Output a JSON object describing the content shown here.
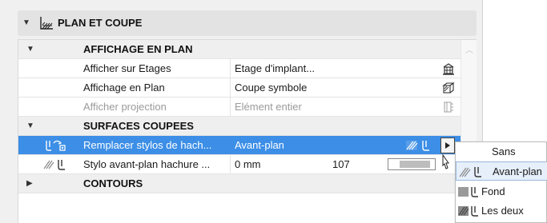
{
  "section": {
    "title": "PLAN ET COUPE",
    "icon": "plan-section-icon"
  },
  "groups": {
    "affichage": "AFFICHAGE EN PLAN",
    "surfaces": "SURFACES COUPEES",
    "contours": "CONTOURS"
  },
  "rows": {
    "afficher_etages": {
      "label": "Afficher sur Etages",
      "value": "Etage d'implant..."
    },
    "affichage_plan": {
      "label": "Affichage en Plan",
      "value": "Coupe symbole"
    },
    "afficher_projection": {
      "label": "Afficher projection",
      "value": "Elément entier"
    },
    "remplacer_stylos": {
      "label": "Remplacer stylos de hach...",
      "value": "Avant-plan"
    },
    "stylo_avant_plan": {
      "label": "Stylo avant-plan hachure ...",
      "value": "0 mm",
      "number": "107"
    }
  },
  "popup": {
    "items": [
      {
        "label": "Sans",
        "icon": "none"
      },
      {
        "label": "Avant-plan",
        "icon": "hatch-pen-icon"
      },
      {
        "label": "Fond",
        "icon": "fill-pen-icon"
      },
      {
        "label": "Les deux",
        "icon": "hatch-fill-pen-icon"
      }
    ],
    "highlighted": "Avant-plan"
  },
  "colors": {
    "selection": "#3c8ee6",
    "group_bg": "#efefef",
    "panel_bg": "#f0f0f0",
    "disabled_text": "#9a9a9a",
    "popup_highlight": "#e6effa"
  }
}
